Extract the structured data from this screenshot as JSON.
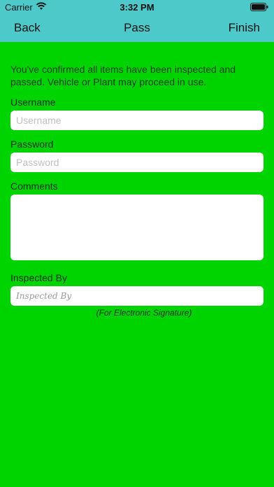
{
  "status_bar": {
    "carrier": "Carrier",
    "time": "3:32 PM",
    "battery_icon": "battery-icon",
    "wifi_icon": "wifi-icon"
  },
  "nav": {
    "back_label": "Back",
    "title": "Pass",
    "finish_label": "Finish"
  },
  "form": {
    "message": "You've confirmed all items have been inspected and passed. Vehicle or Plant may proceed in use.",
    "username_label": "Username",
    "username_placeholder": "Username",
    "password_label": "Password",
    "password_placeholder": "Password",
    "comments_label": "Comments",
    "inspected_by_label": "Inspected By",
    "inspected_by_placeholder": "Inspected By",
    "signature_hint": "(For Electronic Signature)"
  },
  "colors": {
    "background": "#00d400",
    "nav_bar": "#4ec9c9"
  }
}
